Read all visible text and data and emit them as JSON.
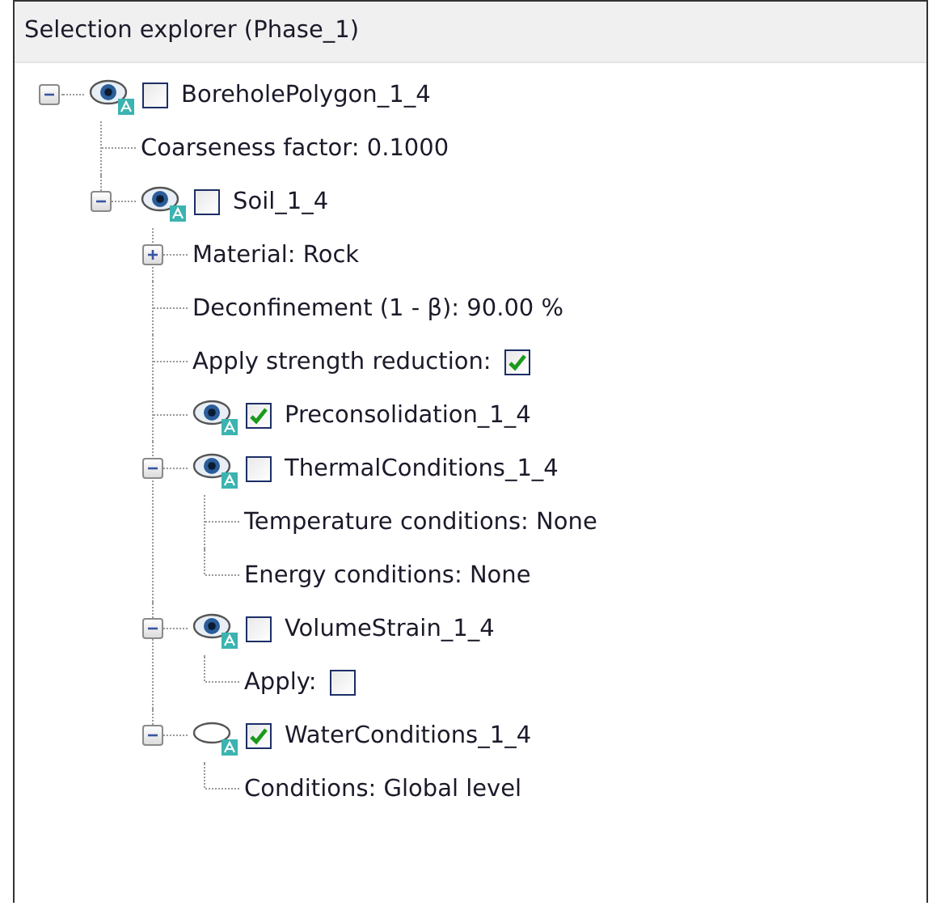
{
  "panel": {
    "title": "Selection explorer (Phase_1)"
  },
  "tree": [
    {
      "kind": "object",
      "label": "BoreholePolygon_1_4",
      "expanded": true,
      "visible": true,
      "checked": false,
      "children": [
        {
          "kind": "property",
          "label": "Coarseness factor: 0.1000"
        },
        {
          "kind": "object",
          "label": "Soil_1_4",
          "expanded": true,
          "visible": true,
          "checked": false,
          "children": [
            {
              "kind": "property",
              "label": "Material: Rock",
              "expanded": false
            },
            {
              "kind": "property",
              "label": "Deconfinement (1 - β): 90.00 %"
            },
            {
              "kind": "toggle",
              "label": "Apply strength reduction:",
              "checked": true
            },
            {
              "kind": "object",
              "label": "Preconsolidation_1_4",
              "visible": true,
              "checked": true
            },
            {
              "kind": "object",
              "label": "ThermalConditions_1_4",
              "expanded": true,
              "visible": true,
              "checked": false,
              "children": [
                {
                  "kind": "property",
                  "label": "Temperature conditions: None"
                },
                {
                  "kind": "property",
                  "label": "Energy conditions: None"
                }
              ]
            },
            {
              "kind": "object",
              "label": "VolumeStrain_1_4",
              "expanded": true,
              "visible": true,
              "checked": false,
              "children": [
                {
                  "kind": "toggle",
                  "label": "Apply:",
                  "checked": false
                }
              ]
            },
            {
              "kind": "object",
              "label": "WaterConditions_1_4",
              "expanded": true,
              "visible": false,
              "checked": true,
              "children": [
                {
                  "kind": "property",
                  "label": "Conditions: Global level"
                }
              ]
            }
          ]
        }
      ]
    }
  ]
}
